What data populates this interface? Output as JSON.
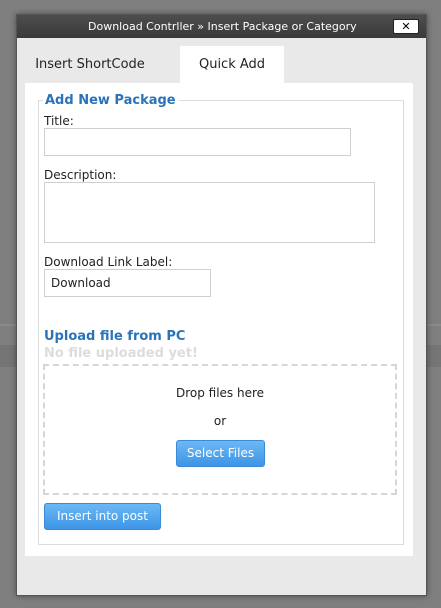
{
  "dialog": {
    "title": "Download Contrller » Insert Package or Category",
    "close_label": "✕"
  },
  "tabs": [
    {
      "label": "Insert ShortCode",
      "active": false
    },
    {
      "label": "Quick Add",
      "active": true
    }
  ],
  "form": {
    "legend": "Add New Package",
    "title_label": "Title:",
    "title_value": "",
    "description_label": "Description:",
    "description_value": "",
    "link_label_label": "Download Link Label:",
    "link_label_value": "Download"
  },
  "upload": {
    "heading": "Upload file from PC",
    "status": "No file uploaded yet!",
    "drop_text": "Drop files here",
    "or_text": "or",
    "select_button": "Select Files"
  },
  "actions": {
    "insert_button": "Insert into post"
  },
  "colors": {
    "accent": "#2a73b9",
    "button_blue": "#4aa0ec"
  }
}
